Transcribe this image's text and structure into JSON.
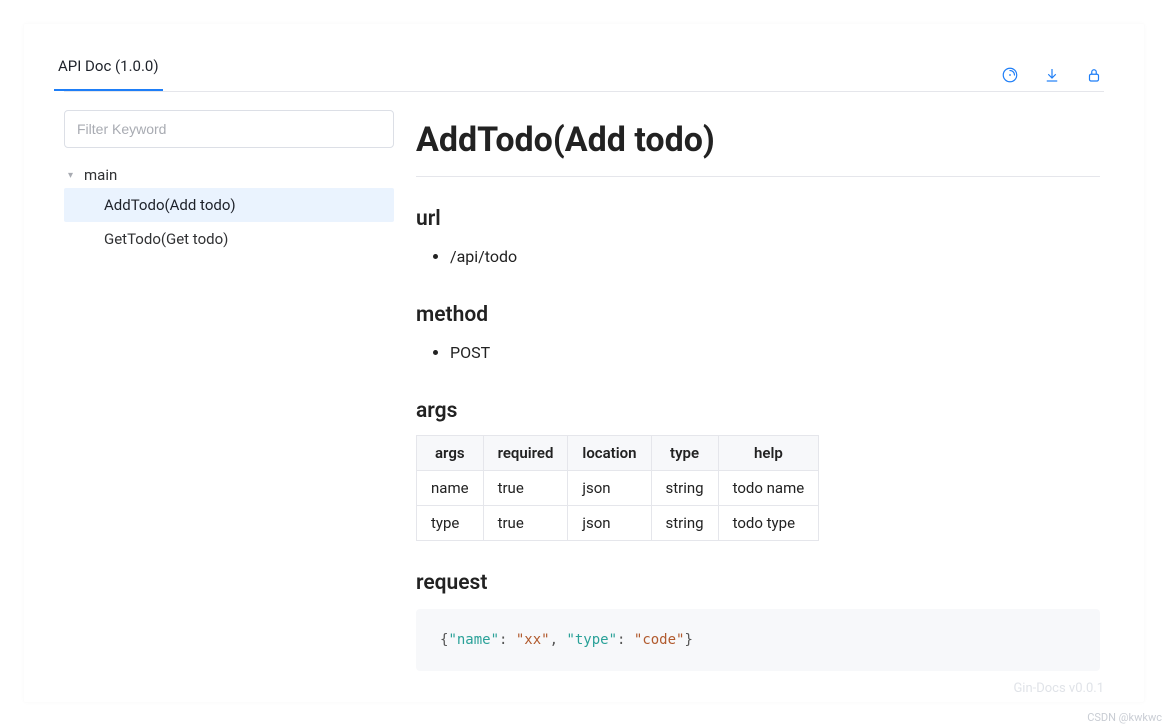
{
  "header": {
    "tab_label": "API Doc (1.0.0)"
  },
  "toolbar": {
    "icons": {
      "clock": "clock-icon",
      "download": "download-icon",
      "lock": "lock-icon"
    }
  },
  "sidebar": {
    "filter_placeholder": "Filter Keyword",
    "group_label": "main",
    "items": [
      {
        "label": "AddTodo(Add todo)",
        "active": true
      },
      {
        "label": "GetTodo(Get todo)",
        "active": false
      }
    ]
  },
  "main": {
    "title": "AddTodo(Add todo)",
    "sections": {
      "url": {
        "heading": "url",
        "value": "/api/todo"
      },
      "method": {
        "heading": "method",
        "value": "POST"
      },
      "args": {
        "heading": "args",
        "columns": [
          "args",
          "required",
          "location",
          "type",
          "help"
        ],
        "rows": [
          {
            "args": "name",
            "required": "true",
            "location": "json",
            "type": "string",
            "help": "todo name"
          },
          {
            "args": "type",
            "required": "true",
            "location": "json",
            "type": "string",
            "help": "todo type"
          }
        ]
      },
      "request": {
        "heading": "request",
        "tokens": [
          {
            "t": "{",
            "c": "p"
          },
          {
            "t": "\"name\"",
            "c": "key"
          },
          {
            "t": ": ",
            "c": "p"
          },
          {
            "t": "\"xx\"",
            "c": "str"
          },
          {
            "t": ", ",
            "c": "p"
          },
          {
            "t": "\"type\"",
            "c": "key"
          },
          {
            "t": ": ",
            "c": "p"
          },
          {
            "t": "\"code\"",
            "c": "str"
          },
          {
            "t": "}",
            "c": "p"
          }
        ]
      }
    }
  },
  "footer": {
    "version": "Gin-Docs v0.0.1",
    "watermark": "CSDN @kwkwc"
  }
}
